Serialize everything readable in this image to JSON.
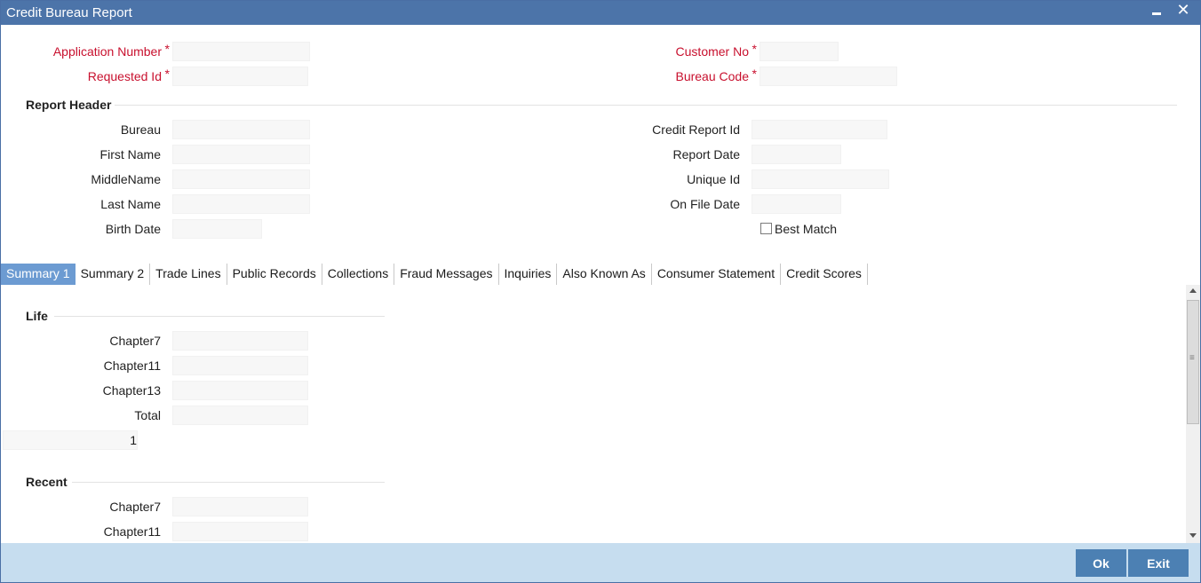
{
  "window": {
    "title": "Credit Bureau Report"
  },
  "header_fields": {
    "application_number": {
      "label": "Application Number",
      "value": ""
    },
    "requested_id": {
      "label": "Requested Id",
      "value": ""
    },
    "customer_no": {
      "label": "Customer No",
      "value": ""
    },
    "bureau_code": {
      "label": "Bureau Code",
      "value": ""
    },
    "required_marker": "*"
  },
  "report_header": {
    "title": "Report Header",
    "bureau": {
      "label": "Bureau",
      "value": ""
    },
    "first_name": {
      "label": "First Name",
      "value": ""
    },
    "middle_name": {
      "label": "MiddleName",
      "value": ""
    },
    "last_name": {
      "label": "Last Name",
      "value": ""
    },
    "birth_date": {
      "label": "Birth Date",
      "value": ""
    },
    "credit_report_id": {
      "label": "Credit Report Id",
      "value": ""
    },
    "report_date": {
      "label": "Report Date",
      "value": ""
    },
    "unique_id": {
      "label": "Unique Id",
      "value": ""
    },
    "on_file_date": {
      "label": "On File Date",
      "value": ""
    },
    "best_match": {
      "label": "Best Match",
      "checked": false
    }
  },
  "tabs": [
    {
      "label": "Summary 1",
      "active": true
    },
    {
      "label": "Summary 2",
      "active": false
    },
    {
      "label": "Trade Lines",
      "active": false
    },
    {
      "label": "Public Records",
      "active": false
    },
    {
      "label": "Collections",
      "active": false
    },
    {
      "label": "Fraud Messages",
      "active": false
    },
    {
      "label": "Inquiries",
      "active": false
    },
    {
      "label": "Also Known As",
      "active": false
    },
    {
      "label": "Consumer Statement",
      "active": false
    },
    {
      "label": "Credit Scores",
      "active": false
    }
  ],
  "summary1": {
    "life": {
      "title": "Life",
      "chapter7": {
        "label": "Chapter7",
        "value": ""
      },
      "chapter11": {
        "label": "Chapter11",
        "value": ""
      },
      "chapter13": {
        "label": "Chapter13",
        "value": ""
      },
      "total": {
        "label": "Total",
        "value": ""
      },
      "count_value": "1"
    },
    "recent": {
      "title": "Recent",
      "chapter7": {
        "label": "Chapter7",
        "value": ""
      },
      "chapter11": {
        "label": "Chapter11",
        "value": ""
      }
    }
  },
  "footer": {
    "ok_label": "Ok",
    "exit_label": "Exit"
  },
  "colors": {
    "titlebar": "#4c74a9",
    "active_tab": "#6c9bd2",
    "footer": "#c6ddef",
    "button": "#4c80b3",
    "required": "#c8102e"
  }
}
